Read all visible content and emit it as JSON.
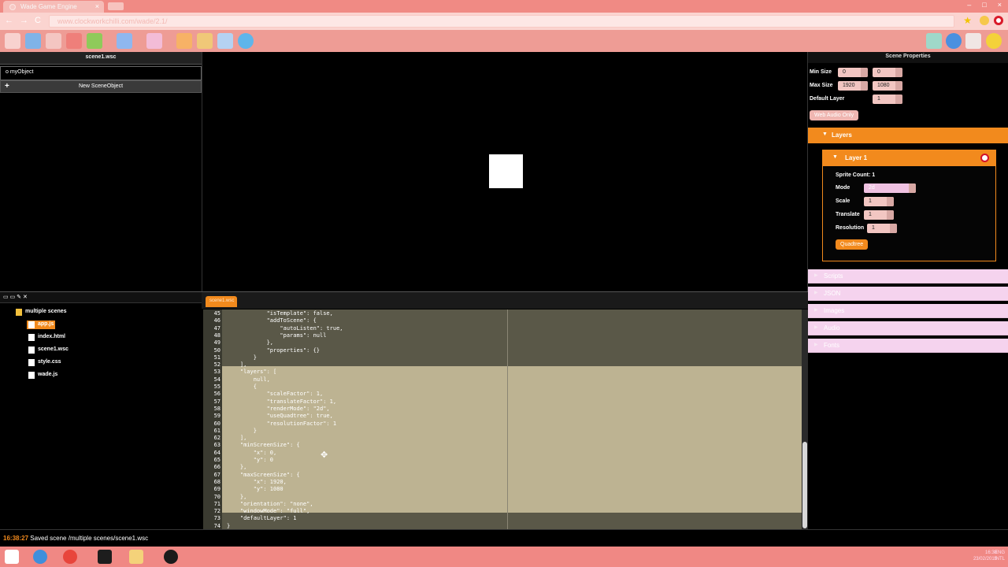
{
  "browser": {
    "tab_title": "Wade Game Engine",
    "tab_close": "×",
    "window_controls": [
      "–",
      "□",
      "×"
    ],
    "url": "www.clockworkchilli.com/wade/2.1/",
    "nav_back": "←",
    "nav_forward": "→",
    "nav_reload": "C",
    "star": "★"
  },
  "scene_panel": {
    "title": "scene1.wsc",
    "objects": [
      {
        "label": "myObject"
      }
    ],
    "new_button": "New SceneObject",
    "new_icon": "+"
  },
  "scene_properties": {
    "title": "Scene Properties",
    "min_size_label": "Min Size",
    "min_size": [
      "0",
      "0"
    ],
    "max_size_label": "Max Size",
    "max_size": [
      "1920",
      "1080"
    ],
    "default_layer_label": "Default Layer",
    "default_layer": "1",
    "web_audio_button": "Web Audio Only",
    "layers_header": "Layers",
    "layer": {
      "title": "Layer 1",
      "sprite_count": "Sprite Count: 1",
      "mode_label": "Mode",
      "mode_value": "2d",
      "scale_label": "Scale",
      "scale": "1",
      "translate_label": "Translate",
      "translate": "1",
      "resolution_label": "Resolution",
      "resolution": "1",
      "quadtree_button": "Quadtree"
    },
    "sections": [
      "Scripts",
      "JSON",
      "Images",
      "Audio",
      "Fonts"
    ]
  },
  "file_tree": {
    "root": "multiple scenes",
    "files": [
      "app.js",
      "index.html",
      "scene1.wsc",
      "style.css",
      "wade.js"
    ],
    "selected": "app.js"
  },
  "editor": {
    "tab": "scene1.wsc",
    "lines": [
      {
        "n": "45",
        "t": "            \"isTemplate\": false,"
      },
      {
        "n": "46",
        "t": "            \"addToScene\": {"
      },
      {
        "n": "47",
        "t": "                \"autoListen\": true,"
      },
      {
        "n": "48",
        "t": "                \"params\": null"
      },
      {
        "n": "49",
        "t": "            },"
      },
      {
        "n": "50",
        "t": "            \"properties\": {}"
      },
      {
        "n": "51",
        "t": "        }"
      },
      {
        "n": "52",
        "t": "    ],"
      },
      {
        "n": "53",
        "t": "    \"layers\": ["
      },
      {
        "n": "54",
        "t": "        null,"
      },
      {
        "n": "55",
        "t": "        {"
      },
      {
        "n": "56",
        "t": "            \"scaleFactor\": 1,"
      },
      {
        "n": "57",
        "t": "            \"translateFactor\": 1,"
      },
      {
        "n": "58",
        "t": "            \"renderMode\": \"2d\","
      },
      {
        "n": "59",
        "t": "            \"useQuadtree\": true,"
      },
      {
        "n": "60",
        "t": "            \"resolutionFactor\": 1"
      },
      {
        "n": "61",
        "t": "        }"
      },
      {
        "n": "62",
        "t": "    ],"
      },
      {
        "n": "63",
        "t": "    \"minScreenSize\": {"
      },
      {
        "n": "64",
        "t": "        \"x\": 0,"
      },
      {
        "n": "65",
        "t": "        \"y\": 0"
      },
      {
        "n": "66",
        "t": "    },"
      },
      {
        "n": "67",
        "t": "    \"maxScreenSize\": {"
      },
      {
        "n": "68",
        "t": "        \"x\": 1920,"
      },
      {
        "n": "69",
        "t": "        \"y\": 1080"
      },
      {
        "n": "70",
        "t": "    },"
      },
      {
        "n": "71",
        "t": "    \"orientation\": \"none\","
      },
      {
        "n": "72",
        "t": "    \"windowMode\": \"full\","
      },
      {
        "n": "73",
        "t": "    \"defaultLayer\": 1"
      },
      {
        "n": "74",
        "t": "}"
      }
    ]
  },
  "status": {
    "time": "16:38:27",
    "message": " Saved scene /multiple scenes/scene1.wsc"
  },
  "taskbar": {
    "tray_lines": [
      "ENG",
      "INTL",
      "16:38",
      "23/02/2015"
    ]
  },
  "colors": {
    "accent": "#f28a1d",
    "chrome": "#f08a84",
    "editor_bg": "#5a5848",
    "selection": "#bdb392"
  }
}
